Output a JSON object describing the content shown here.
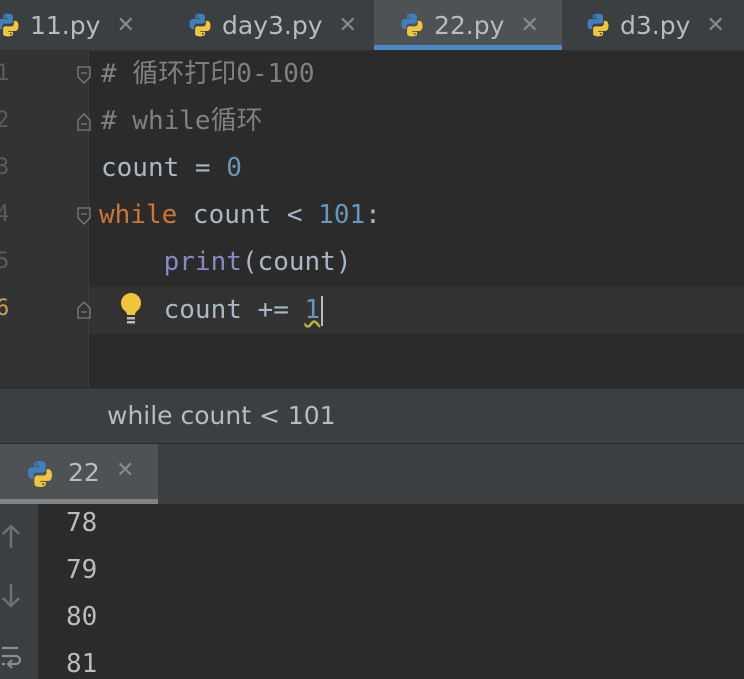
{
  "tabs": [
    {
      "label": "11.py",
      "close": "✕"
    },
    {
      "label": "day3.py",
      "close": "✕"
    },
    {
      "label": "22.py",
      "close": "✕",
      "active": true
    },
    {
      "label": "d3.py",
      "close": "✕"
    }
  ],
  "editor": {
    "line_numbers": [
      "1",
      "2",
      "3",
      "4",
      "5",
      "6"
    ],
    "lines": {
      "l1": "# 循环打印0-100",
      "l2": "# while循环",
      "l3_var": "count",
      "l3_op": " = ",
      "l3_num": "0",
      "l4_kw": "while",
      "l4_mid": " count < ",
      "l4_num": "101",
      "l4_end": ":",
      "l5_indent": "    ",
      "l5_fn": "print",
      "l5_rest": "(count)",
      "l6_indent": "    ",
      "l6_text": "count += ",
      "l6_num": "1"
    }
  },
  "breadcrumb": "while count < 101",
  "run": {
    "tab_label": "22",
    "close": "✕",
    "output": [
      "78",
      "79",
      "80",
      "81"
    ]
  },
  "colors": {
    "keyword": "#cc7832",
    "number": "#6897bb",
    "comment": "#808080",
    "builtin": "#8888c6",
    "accent": "#4a88c7"
  },
  "icons": [
    "python-icon",
    "close-icon",
    "lightbulb-icon",
    "fold-icon",
    "arrow-up-icon",
    "arrow-down-icon",
    "soft-wrap-icon"
  ]
}
